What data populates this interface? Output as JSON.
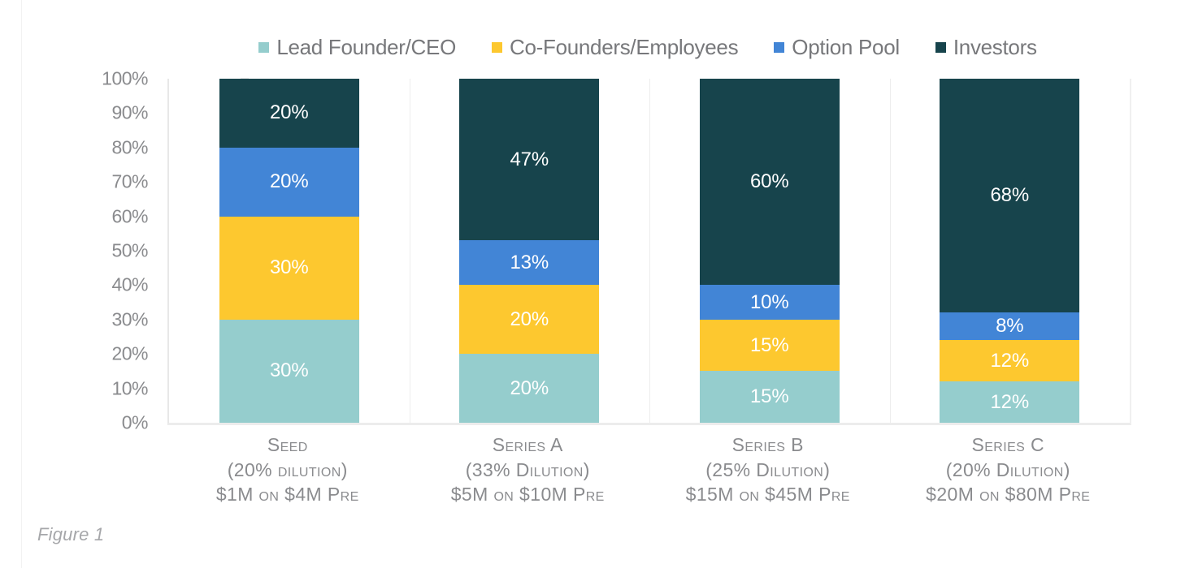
{
  "figure": {
    "caption": "Figure 1"
  },
  "legend": {
    "position": "top-center",
    "items": [
      {
        "label": "Lead Founder/CEO",
        "color": "#95cdcd",
        "swatch": "square-swatch"
      },
      {
        "label": "Co-Founders/Employees",
        "color": "#fdc82f",
        "swatch": "square-swatch"
      },
      {
        "label": "Option Pool",
        "color": "#4285d6",
        "swatch": "square-swatch"
      },
      {
        "label": "Investors",
        "color": "#17444c",
        "swatch": "square-swatch"
      }
    ]
  },
  "axis": {
    "y_ticks": [
      "100%",
      "90%",
      "80%",
      "70%",
      "60%",
      "50%",
      "40%",
      "30%",
      "20%",
      "10%",
      "0%"
    ],
    "y_tick_values": [
      100,
      90,
      80,
      70,
      60,
      50,
      40,
      30,
      20,
      10,
      0
    ]
  },
  "categories_detail": [
    {
      "name": "Seed",
      "line1": "Seed",
      "line2": "(20% dilution)",
      "line3": "$1M on $4M Pre"
    },
    {
      "name": "Series A",
      "line1": "Series A",
      "line2": "(33% Dilution)",
      "line3": "$5M on $10M Pre"
    },
    {
      "name": "Series B",
      "line1": "Series B",
      "line2": "(25% Dilution)",
      "line3": "$15M on $45M Pre"
    },
    {
      "name": "Series C",
      "line1": "Series C",
      "line2": "(20% Dilution)",
      "line3": "$20M on $80M Pre"
    }
  ],
  "chart_data": {
    "type": "bar",
    "stacked": true,
    "stack_total": 100,
    "title": "",
    "xlabel": "",
    "ylabel": "",
    "ylim": [
      0,
      100
    ],
    "grid": false,
    "legend_position": "top-center",
    "categories": [
      "Seed",
      "Series A",
      "Series B",
      "Series C"
    ],
    "series": [
      {
        "name": "Lead Founder/CEO",
        "color": "#95cdcd",
        "values": [
          30,
          20,
          15,
          12
        ],
        "labels": [
          "30%",
          "20%",
          "15%",
          "12%"
        ]
      },
      {
        "name": "Co-Founders/Employees",
        "color": "#fdc82f",
        "values": [
          30,
          20,
          15,
          12
        ],
        "labels": [
          "30%",
          "20%",
          "15%",
          "12%"
        ]
      },
      {
        "name": "Option Pool",
        "color": "#4285d6",
        "values": [
          20,
          13,
          10,
          8
        ],
        "labels": [
          "20%",
          "13%",
          "10%",
          "8%"
        ]
      },
      {
        "name": "Investors",
        "color": "#17444c",
        "values": [
          20,
          47,
          60,
          68
        ],
        "labels": [
          "20%",
          "47%",
          "60%",
          "68%"
        ]
      }
    ]
  }
}
